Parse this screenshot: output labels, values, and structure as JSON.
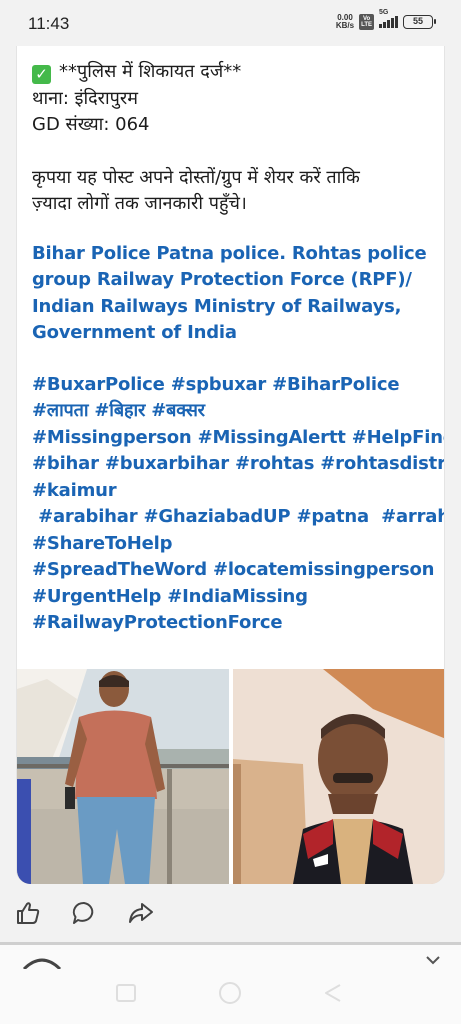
{
  "status_bar": {
    "time": "11:43",
    "net_speed_value": "0.00",
    "net_speed_unit": "KB/s",
    "volte_line1": "Vo",
    "volte_line2": "LTE",
    "network": "5G",
    "battery": "55"
  },
  "post": {
    "lines_black": [
      "**पुलिस में शिकायत दर्ज**",
      "थाना: इंदिरापुरम",
      "GD संख्या: 064",
      "कृपया यह पोस्ट अपने दोस्तों/ग्रुप में शेयर करें ताकि",
      "ज़्यादा लोगों तक जानकारी पहुँचे।"
    ],
    "mentions": [
      "Bihar Police  Patna police. Rohtas police",
      "group   Railway Protection Force (RPF)/",
      "Indian Railways Ministry of Railways,",
      "Government of India"
    ],
    "hashtags": [
      "#BuxarPolice  #spbuxar #BiharPolice",
      "#लापता #बिहार #बक्सर",
      "#Missingperson #MissingAlertt #HelpFind",
      "#bihar #buxarbihar #rohtas #rohtasdistrict",
      "#kaimur",
      " #arabihar #GhaziabadUP #patna  #arrah",
      "#ShareToHelp",
      "#SpreadTheWord #locatemissingperson",
      "#UrgentHelp  #IndiaMissing",
      "#RailwayProtectionForce"
    ],
    "icon_check": "check-mark-icon"
  },
  "photos": [
    {
      "icon": "photo-man-standing"
    },
    {
      "icon": "photo-man-portrait"
    }
  ],
  "actions": {
    "like_icon": "thumbs-up-icon",
    "comment_icon": "comment-icon",
    "share_icon": "share-icon"
  },
  "colors": {
    "hashtag_blue": "#1a64b4",
    "check_green": "#44b94a",
    "background": "#f2f2f2"
  }
}
